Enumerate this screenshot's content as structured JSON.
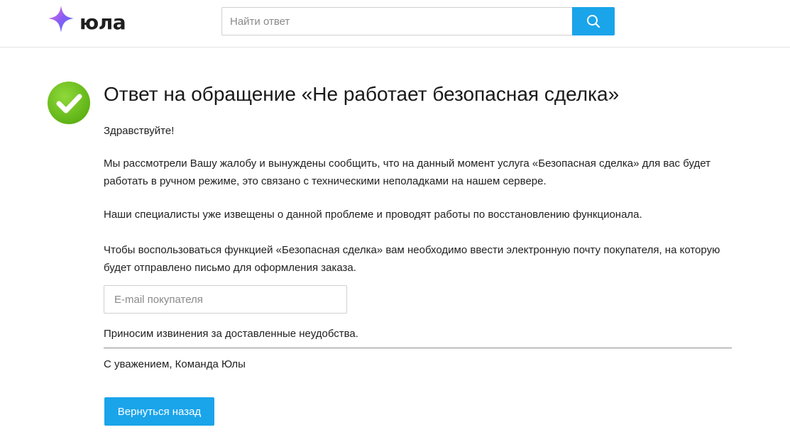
{
  "header": {
    "logo_text": "юла",
    "search": {
      "placeholder": "Найти ответ",
      "button_icon": "search-icon"
    }
  },
  "status_icon": "check-circle-icon",
  "content": {
    "title": "Ответ на обращение «Не работает безопасная сделка»",
    "greeting": "Здравствуйте!",
    "paragraph_1": "Мы рассмотрели Вашу жалобу и вынуждены сообщить, что на данный момент услуга «Безопасная сделка» для вас будет работать в ручном режиме, это связано с техническими неполадками на нашем сервере.",
    "paragraph_2": "Наши специалисты уже извещены о данной проблеме и проводят работы по восстановлению функционала.",
    "paragraph_3": "Чтобы воспользоваться функцией «Безопасная сделка» вам необходимо ввести электронную почту покупателя, на которую будет отправлено письмо для оформления заказа.",
    "email_placeholder": "E-mail покупателя",
    "apology": "Приносим извинения за доставленные неудобства.",
    "signature": "С уважением, Команда Юлы",
    "back_button_label": "Вернуться назад"
  },
  "colors": {
    "accent": "#1aa4ea",
    "success": "#6cc11c",
    "logo_gradient": [
      "#f27ad3",
      "#8a5cf6",
      "#3d7cf5"
    ]
  }
}
